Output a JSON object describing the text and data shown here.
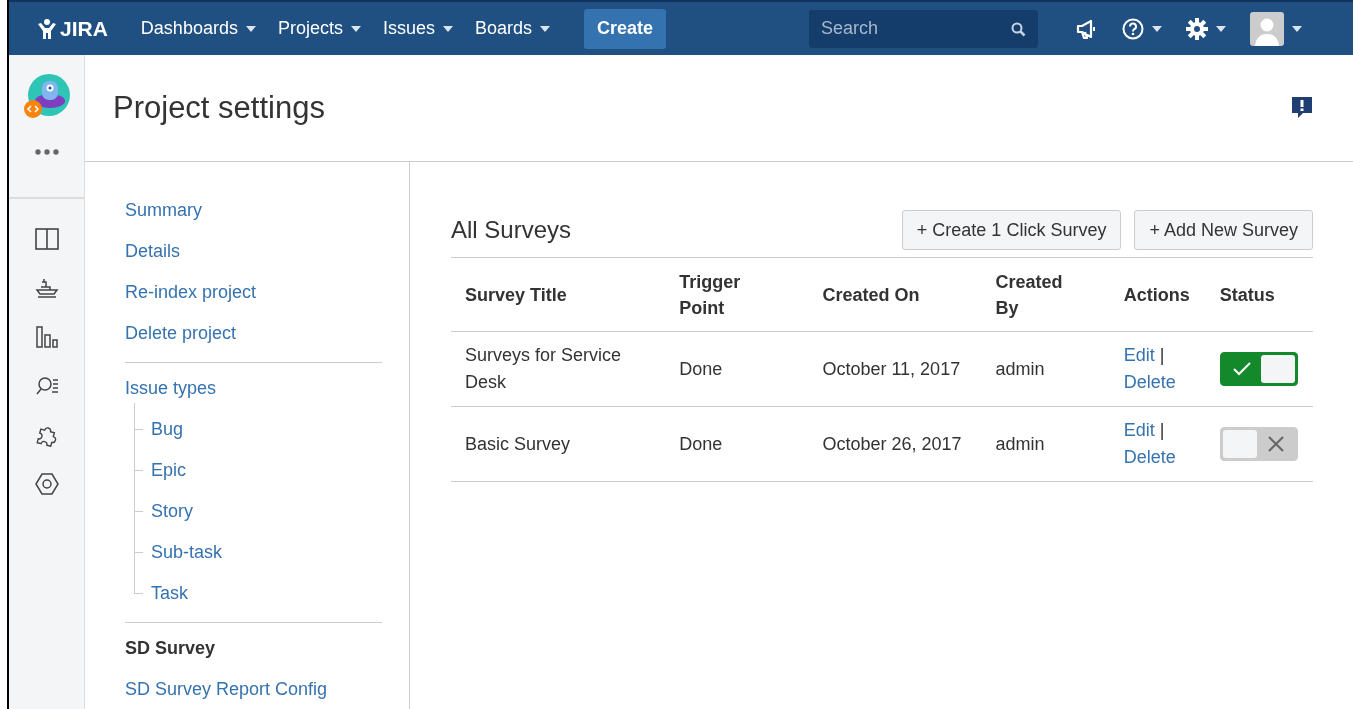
{
  "header": {
    "logo": "JIRA",
    "nav": [
      {
        "label": "Dashboards"
      },
      {
        "label": "Projects"
      },
      {
        "label": "Issues"
      },
      {
        "label": "Boards"
      }
    ],
    "create": "Create",
    "search": {
      "placeholder": "Search"
    }
  },
  "page": {
    "title": "Project settings"
  },
  "settings_nav": {
    "groups": [
      {
        "items": [
          {
            "label": "Summary"
          },
          {
            "label": "Details"
          },
          {
            "label": "Re-index project"
          },
          {
            "label": "Delete project"
          }
        ]
      },
      {
        "items": [
          {
            "label": "Issue types",
            "children": [
              {
                "label": "Bug"
              },
              {
                "label": "Epic"
              },
              {
                "label": "Story"
              },
              {
                "label": "Sub-task"
              },
              {
                "label": "Task"
              }
            ]
          }
        ]
      },
      {
        "heading": "SD Survey",
        "items": [
          {
            "label": "SD Survey Report Config"
          }
        ]
      }
    ]
  },
  "surveys": {
    "title": "All Surveys",
    "buttons": [
      "+ Create 1 Click Survey",
      "+ Add New Survey"
    ],
    "columns": [
      "Survey Title",
      "Trigger Point",
      "Created On",
      "Created By",
      "Actions",
      "Status"
    ],
    "rows": [
      {
        "title": "Surveys for Service Desk",
        "trigger": "Done",
        "created_on": "October 11, 2017",
        "created_by": "admin",
        "edit": "Edit",
        "separator": "|",
        "delete": "Delete",
        "on": true
      },
      {
        "title": "Basic Survey",
        "trigger": "Done",
        "created_on": "October 26, 2017",
        "created_by": "admin",
        "edit": "Edit",
        "separator": "|",
        "delete": "Delete",
        "on": false
      }
    ]
  }
}
